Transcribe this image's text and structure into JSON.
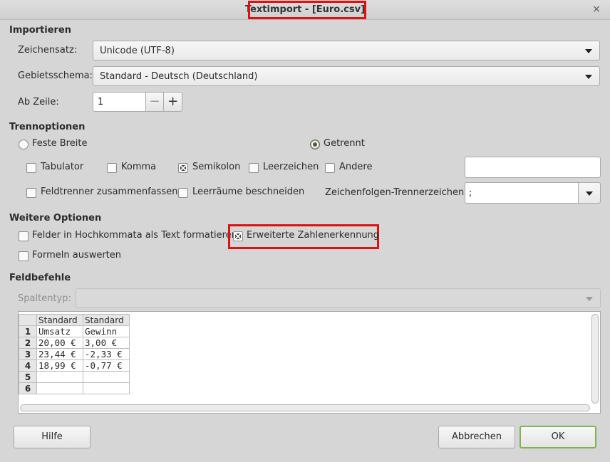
{
  "window": {
    "title": "Textimport - [Euro.csv]",
    "close_glyph": "×"
  },
  "import": {
    "section_title": "Importieren",
    "charset_label": "Zeichensatz:",
    "charset_value": "Unicode (UTF-8)",
    "locale_label": "Gebietsschema:",
    "locale_value": "Standard - Deutsch (Deutschland)",
    "from_row_label": "Ab Zeile:",
    "from_row_value": "1",
    "minus_glyph": "−",
    "plus_glyph": "+"
  },
  "separator": {
    "section_title": "Trennoptionen",
    "fixed_width_label": "Feste Breite",
    "fixed_width_selected": false,
    "separated_label": "Getrennt",
    "separated_selected": true,
    "tab_label": "Tabulator",
    "tab_checked": false,
    "comma_label": "Komma",
    "comma_checked": false,
    "semicolon_label": "Semikolon",
    "semicolon_checked": true,
    "space_label": "Leerzeichen",
    "space_checked": false,
    "other_label": "Andere",
    "other_checked": false,
    "other_value": "",
    "merge_label": "Feldtrenner zusammenfassen",
    "merge_checked": false,
    "trim_label": "Leerräume beschneiden",
    "trim_checked": false,
    "string_delim_label": "Zeichenfolgen-Trennerzeichen:",
    "string_delim_value": ";"
  },
  "other_options": {
    "section_title": "Weitere Optionen",
    "quoted_as_text_label": "Felder in Hochkommata als Text formatieren",
    "quoted_as_text_checked": false,
    "detect_special_numbers_label": "Erweiterte Zahlenerkennung",
    "detect_special_numbers_checked": true,
    "evaluate_formulas_label": "Formeln auswerten",
    "evaluate_formulas_checked": false
  },
  "fields": {
    "section_title": "Feldbefehle",
    "column_type_label": "Spaltentyp:",
    "column_type_value": ""
  },
  "preview": {
    "headers": [
      "Standard",
      "Standard"
    ],
    "rows": [
      {
        "num": "1",
        "cells": [
          "Umsatz",
          "Gewinn"
        ]
      },
      {
        "num": "2",
        "cells": [
          "20,00 €",
          "3,00 €"
        ]
      },
      {
        "num": "3",
        "cells": [
          "23,44 €",
          "-2,33 €"
        ]
      },
      {
        "num": "4",
        "cells": [
          "18,99 €",
          "-0,77 €"
        ]
      },
      {
        "num": "5",
        "cells": [
          "",
          ""
        ]
      },
      {
        "num": "6",
        "cells": [
          "",
          ""
        ]
      }
    ]
  },
  "buttons": {
    "help": "Hilfe",
    "cancel": "Abbrechen",
    "ok": "OK"
  },
  "colors": {
    "highlight": "#e01010",
    "ok_border": "#80b255",
    "dialog_bg": "#d6d6d6"
  }
}
